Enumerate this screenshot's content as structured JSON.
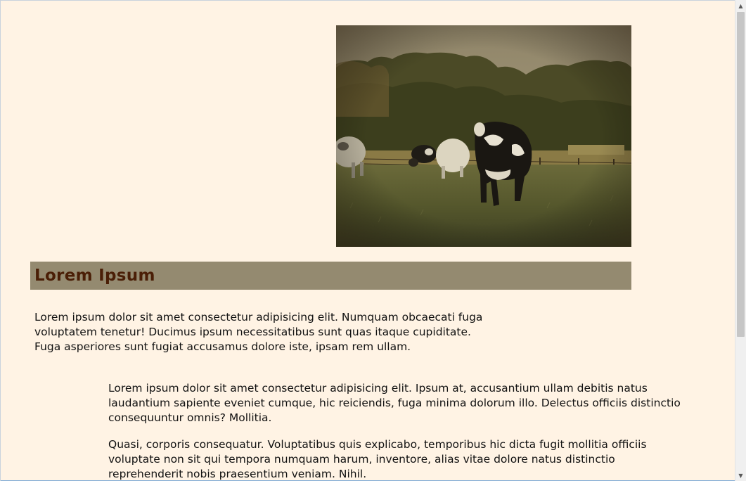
{
  "image": {
    "alt_semantic": "cows-in-pasture-photo"
  },
  "heading": {
    "title": "Lorem Ipsum"
  },
  "paragraphs": [
    "Lorem ipsum dolor sit amet consectetur adipisicing elit. Numquam obcaecati fuga voluptatem tenetur! Ducimus ipsum necessitatibus sunt quas itaque cupiditate. Fuga asperiores sunt fugiat accusamus dolore iste, ipsam rem ullam.",
    "Lorem ipsum dolor sit amet consectetur adipisicing elit. Ipsum at, accusantium ullam debitis natus laudantium sapiente eveniet cumque, hic reiciendis, fuga minima dolorum illo. Delectus officiis distinctio consequuntur omnis? Mollitia.",
    "Quasi, corporis consequatur. Voluptatibus quis explicabo, temporibus hic dicta fugit mollitia officiis voluptate non sit qui tempora numquam harum, inventore, alias vitae dolore natus distinctio reprehenderit nobis praesentium veniam. Nihil."
  ],
  "scrollbar": {
    "up_icon": "▲",
    "down_icon": "▼"
  },
  "colors": {
    "page_background": "#fff3e4",
    "banner_background": "#948a70",
    "heading_text": "#4a1e06"
  }
}
